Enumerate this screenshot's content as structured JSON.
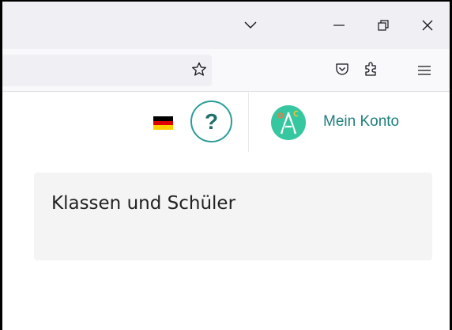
{
  "window": {
    "controls": [
      {
        "icon": "chevron-down-icon"
      },
      {
        "icon": "minimize-icon"
      },
      {
        "icon": "restore-icon"
      },
      {
        "icon": "close-icon"
      }
    ]
  },
  "toolbar": {
    "icons": [
      "bookmark-star-icon",
      "pocket-icon",
      "extensions-icon",
      "menu-icon"
    ]
  },
  "header": {
    "language_flag": "de",
    "help_label": "?",
    "account_label": "Mein Konto",
    "colors": {
      "accent": "#2a9d9a",
      "avatar_bg": "#37c7a0"
    }
  },
  "main": {
    "card_title": "Klassen und Schüler"
  }
}
